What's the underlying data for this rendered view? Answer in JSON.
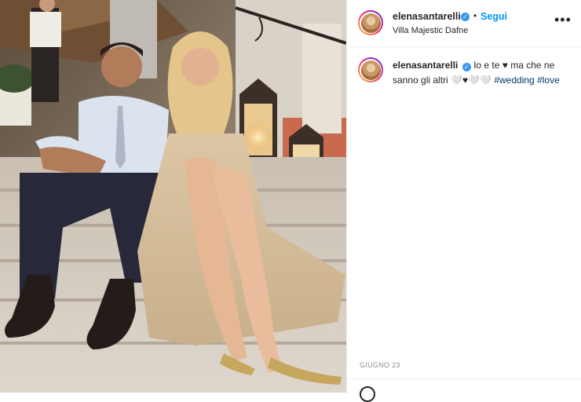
{
  "post": {
    "header": {
      "username": "elenasantarelli",
      "verified_mark": "✓",
      "separator": "•",
      "follow_label": "Segui",
      "location": "Villa Majestic Dafne",
      "more_icon": "more-horizontal-icon",
      "more_label": "•••"
    },
    "caption": {
      "username": "elenasantarelli",
      "verified_mark": "✓",
      "text": "Io e te ♥ ma che ne sanno gli altri 🤍♥🤍🤍",
      "hashtag_1": "#wedding",
      "hashtag_2": "#love"
    },
    "date": "GIUGNO 23",
    "colors": {
      "accent": "#0095f6",
      "verified": "#3897f0",
      "hashtag": "#00376b",
      "muted": "#8e8e8e"
    }
  }
}
